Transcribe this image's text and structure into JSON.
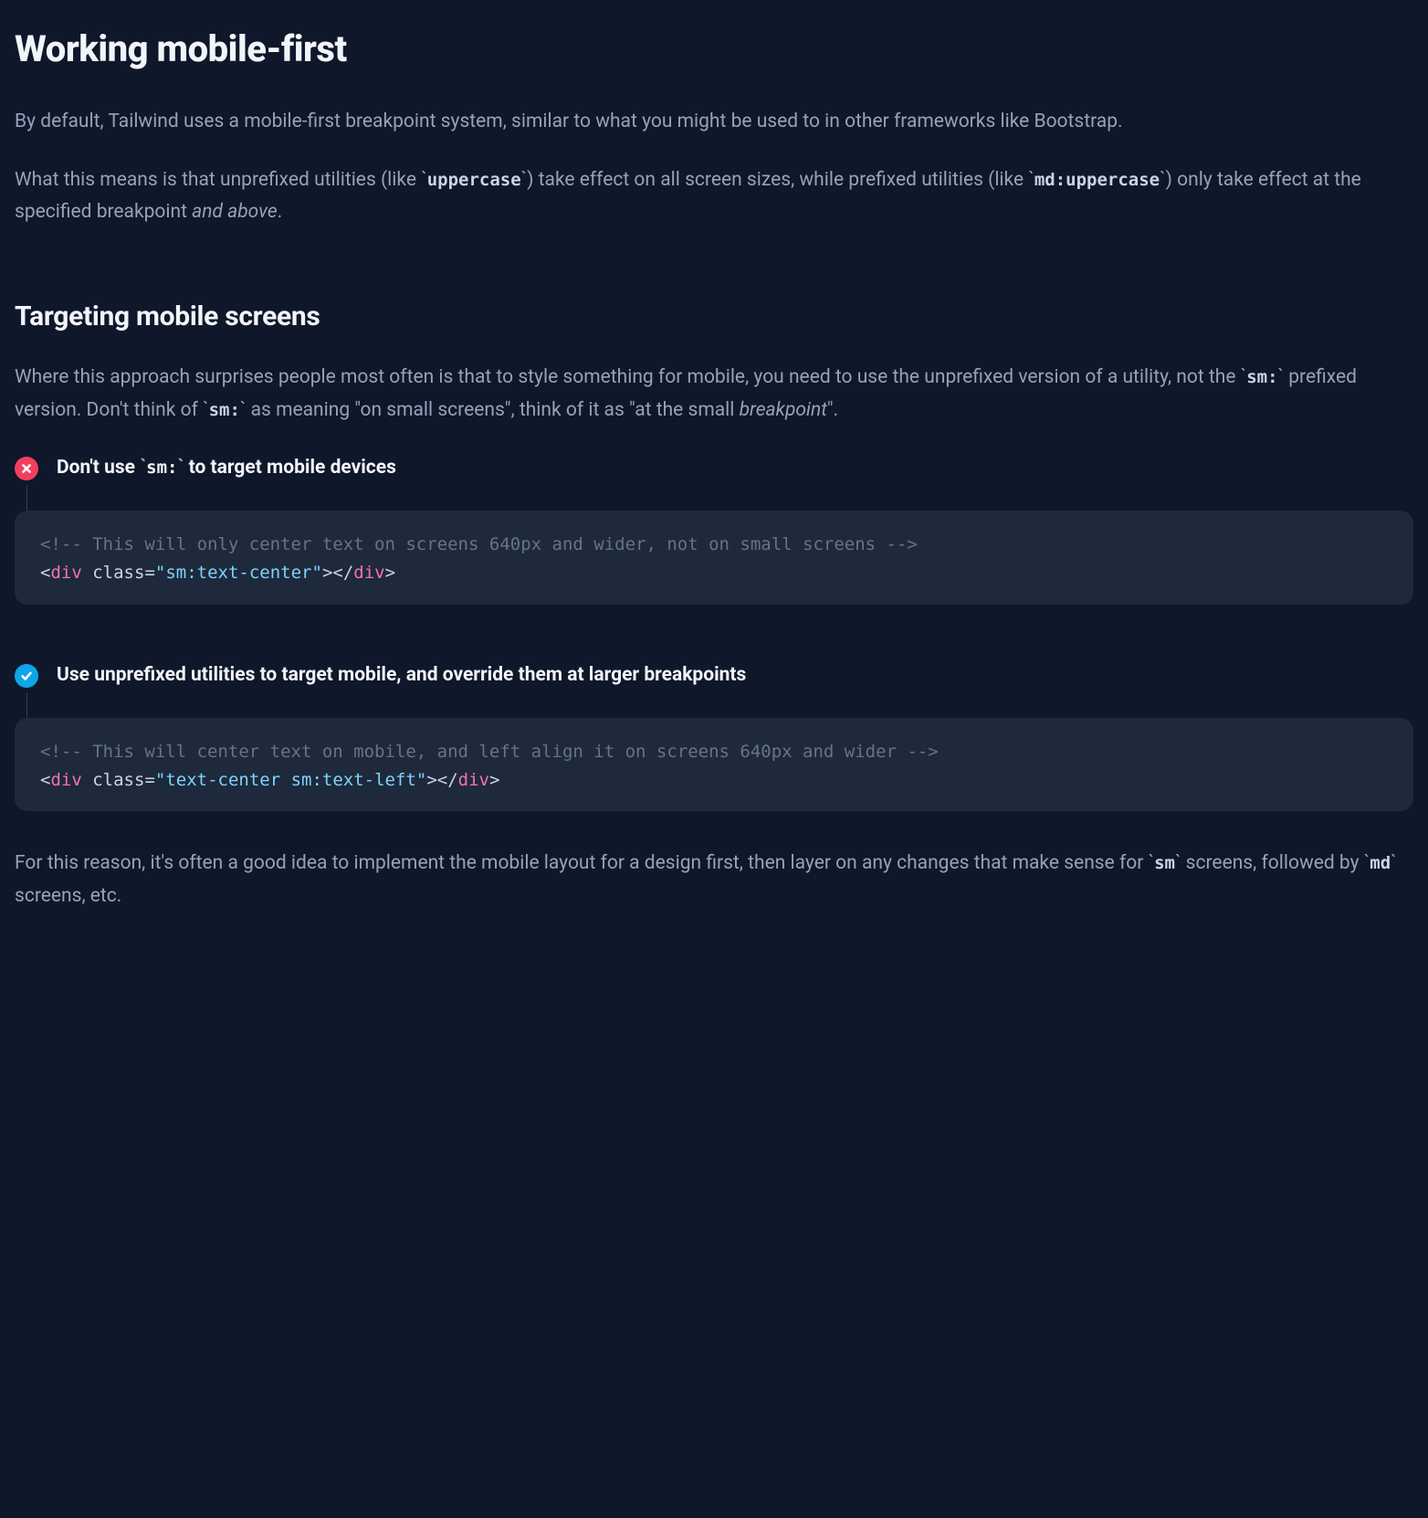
{
  "heading_main": "Working mobile-first",
  "intro_p1": "By default, Tailwind uses a mobile-first breakpoint system, similar to what you might be used to in other frameworks like Bootstrap.",
  "intro_p2": {
    "pre1": "What this means is that unprefixed utilities (like ",
    "code1": "uppercase",
    "mid1": ") take effect on all screen sizes, while prefixed utilities (like ",
    "code2": "md:uppercase",
    "mid2": ") only take effect at the specified breakpoint ",
    "em": "and above",
    "post": "."
  },
  "heading_sub": "Targeting mobile screens",
  "sub_p1": {
    "pre1": "Where this approach surprises people most often is that to style something for mobile, you need to use the unprefixed version of a utility, not the ",
    "code1": "sm:",
    "mid1": " prefixed version. Don't think of ",
    "code2": "sm:",
    "mid2": " as meaning \"on small screens\", think of it as \"at the small ",
    "em": "breakpoint",
    "post": "\"."
  },
  "callout_bad": {
    "title_pre": "Don't use ",
    "title_code": "sm:",
    "title_post": " to target mobile devices",
    "code_comment": "<!-- This will only center text on screens 640px and wider, not on small screens -->",
    "code_tag_open": "div",
    "code_attr": "class",
    "code_str": "sm:text-center",
    "code_tag_close": "div"
  },
  "callout_good": {
    "title": "Use unprefixed utilities to target mobile, and override them at larger breakpoints",
    "code_comment": "<!-- This will center text on mobile, and left align it on screens 640px and wider -->",
    "code_tag_open": "div",
    "code_attr": "class",
    "code_str": "text-center sm:text-left",
    "code_tag_close": "div"
  },
  "closing_p": {
    "pre": "For this reason, it's often a good idea to implement the mobile layout for a design first, then layer on any changes that make sense for ",
    "code1": "sm",
    "mid": " screens, followed by ",
    "code2": "md",
    "post": " screens, etc."
  }
}
